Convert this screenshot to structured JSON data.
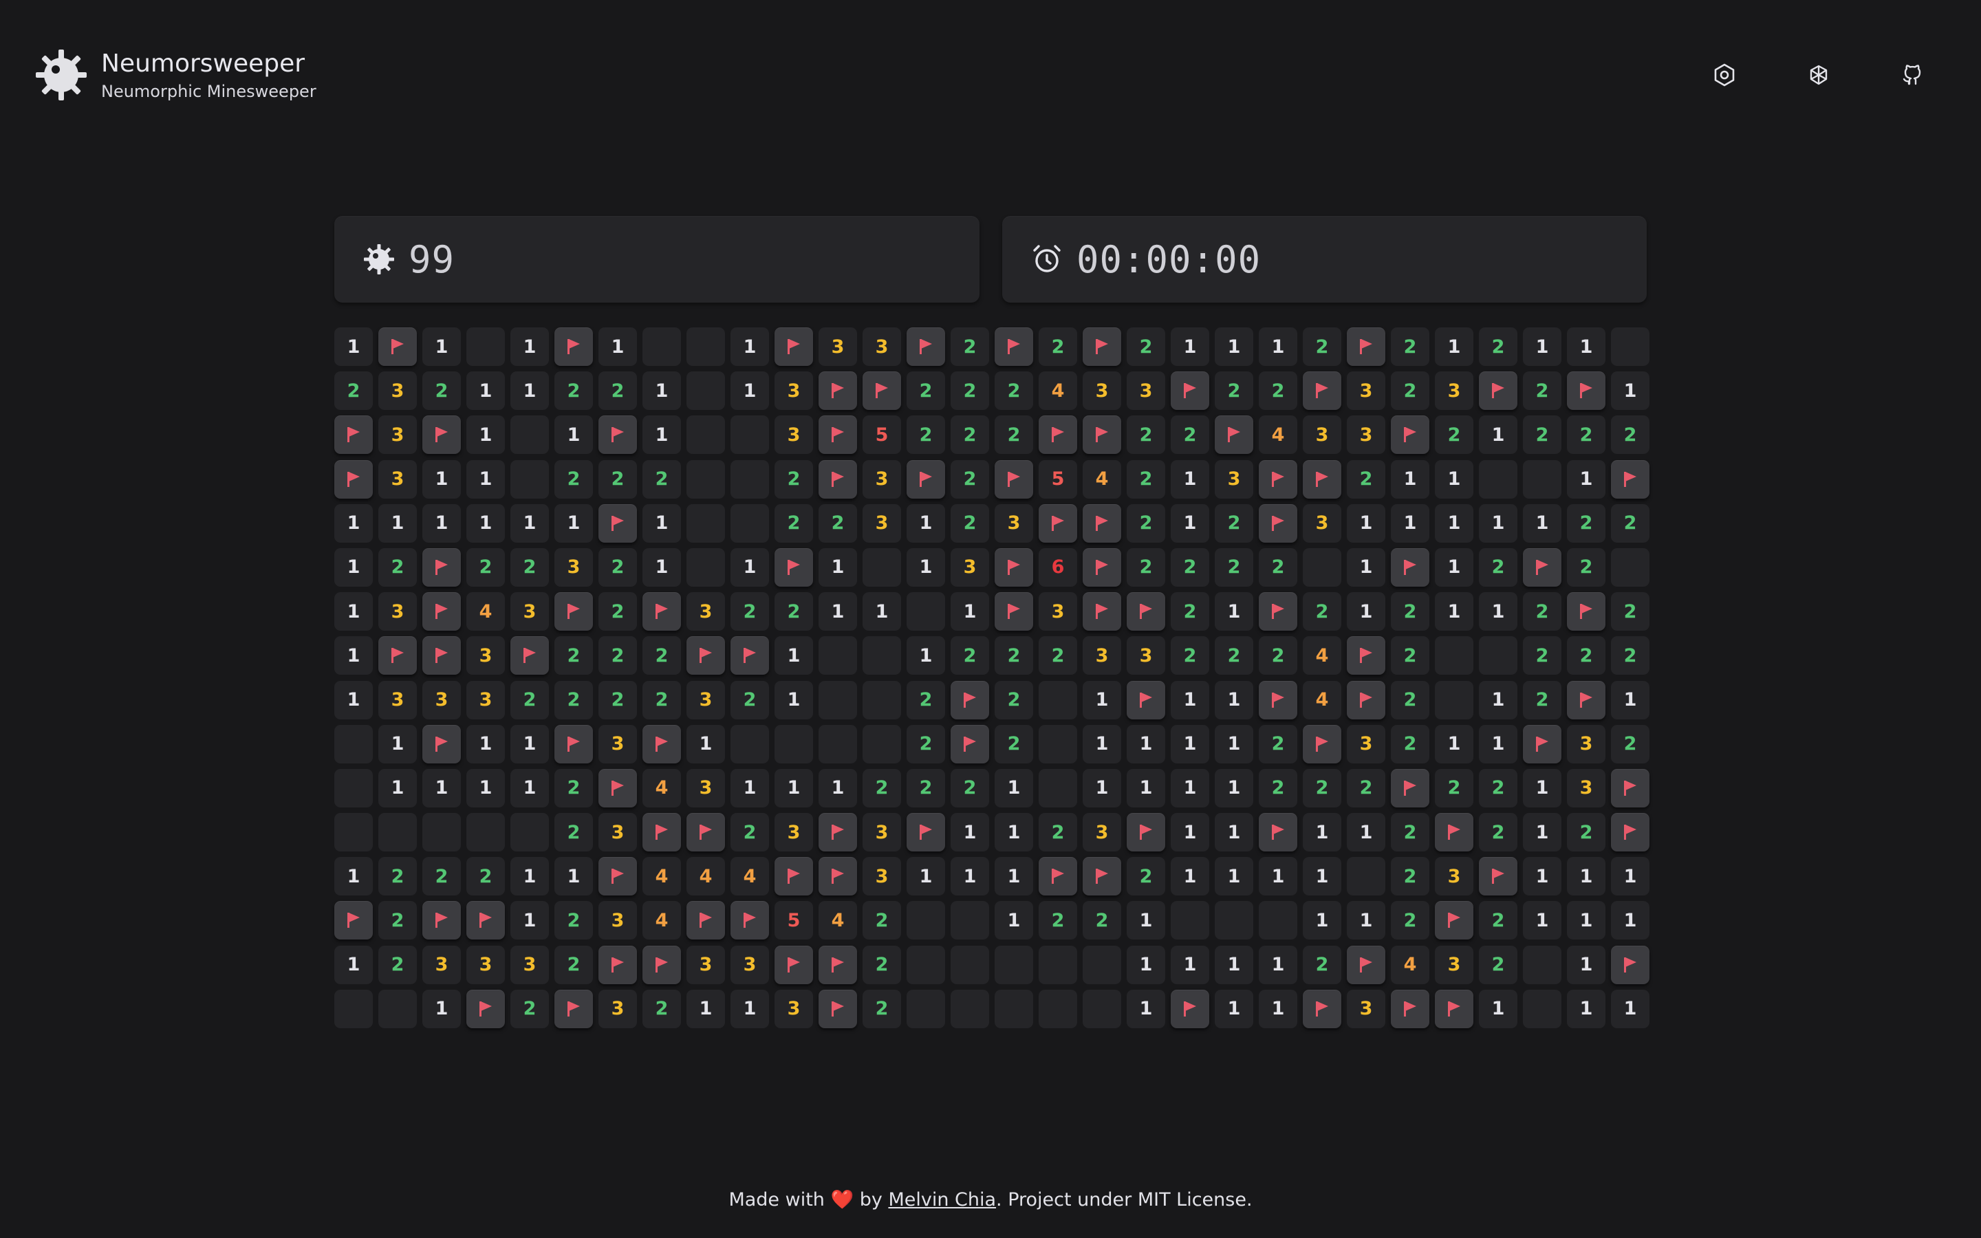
{
  "app": {
    "title": "Neumorsweeper",
    "subtitle": "Neumorphic Minesweeper"
  },
  "header_buttons": [
    {
      "icon": "settings-icon"
    },
    {
      "icon": "openai-icon"
    },
    {
      "icon": "github-icon"
    }
  ],
  "status": {
    "mine_count": "99",
    "timer": "00:00:00"
  },
  "colors": {
    "background": "#18181a",
    "panel": "#252528",
    "flag": "#e85a6b",
    "n1": "#e4e4ea",
    "n2": "#54c774",
    "n3": "#f4bd2c",
    "n4": "#f2a042",
    "n5": "#ef5a55",
    "n6": "#e8393f"
  },
  "board": {
    "rows": 16,
    "cols": 30,
    "legend": "F = flagged cell, 0 = empty revealed cell, 1-8 = adjacent mine count",
    "cells": [
      "1F1.1F1..1F33F2F2F21112F21211",
      "23211221.13FF22243 3F22F323F2F1",
      "F3F1.1F1..3F522 2FF22F433F21222",
      "F311.222..2F3F2F542 13FF211..1F",
      "111111F1..22312 3FF212F3111 1122",
      "12F2232 1.1F1.13F6F2222.1F12F2",
      "13F43F2F3221 1.1F3FF21F212112F2",
      "1FF3F222FF1..122233222 4F2..222",
      "13332222321..2F2.1F11F4F2.12F1",
      ".1F11F3F1....2F2.111 12F32 11F32",
      ".11112F4311122 21.11112 22F2213F",
      ".....23FF23F3F1 123F11F112F212F",
      "12221 1F444FF3111FF2111 1.23F111",
      "F2FF1234FF542..1221...112F2111",
      "1233 32FF33FF2.....111 12F432.1F",
      "..1F2F32113F2.....1F11F3FF1.11"
    ]
  },
  "footer": {
    "prefix": "Made with",
    "heart": "❤️",
    "by": "by",
    "author": "Melvin Chia",
    "suffix": ". Project under MIT License."
  }
}
